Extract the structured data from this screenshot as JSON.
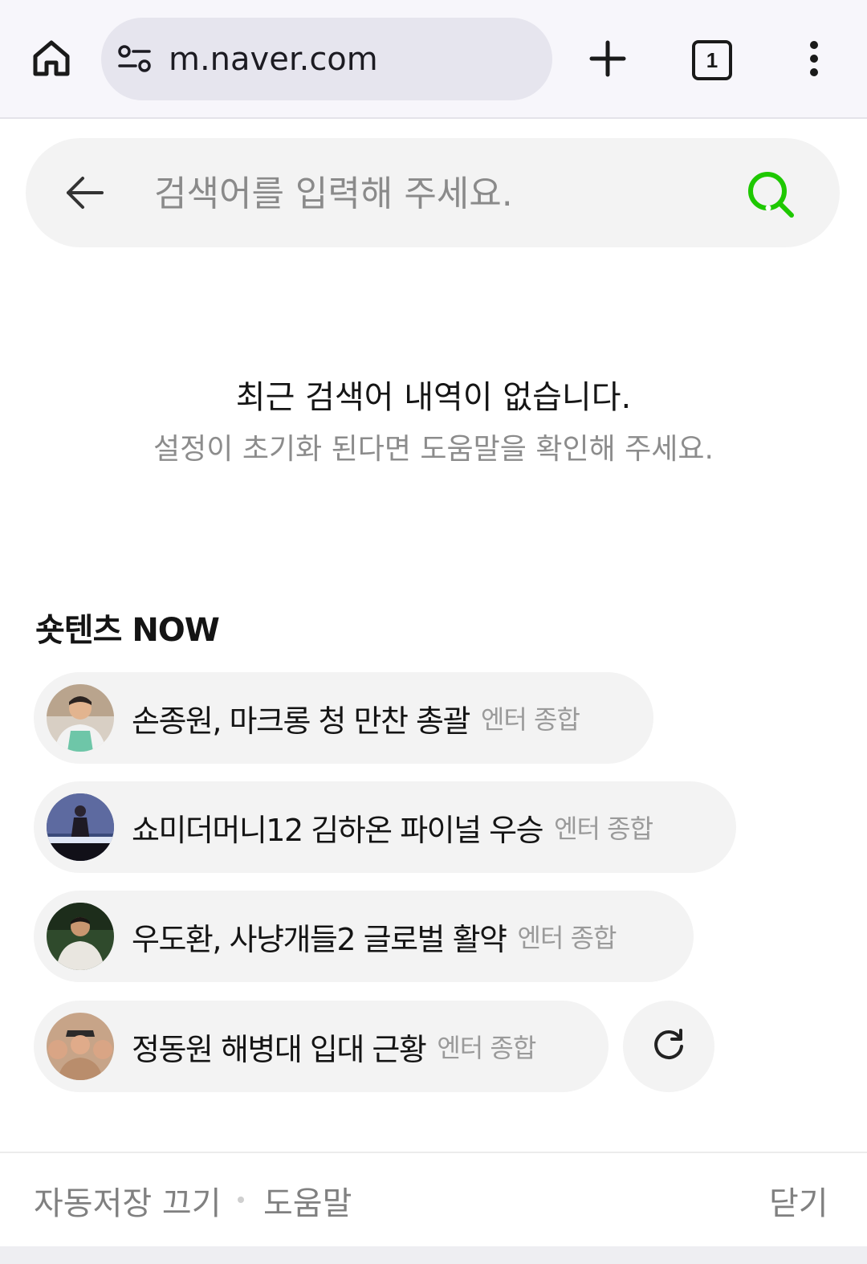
{
  "browser": {
    "url": "m.naver.com",
    "tab_count": "1",
    "icons": {
      "home": "home-icon",
      "site_settings": "site-settings-icon",
      "new_tab": "plus-icon",
      "tabs": "tab-switcher-icon",
      "menu": "more-vert-icon"
    }
  },
  "search": {
    "placeholder": "검색어를 입력해 주세요.",
    "back_icon": "arrow-left-icon",
    "search_icon": "search-icon",
    "accent_color": "#1ec800"
  },
  "recent": {
    "empty_title": "최근 검색어 내역이 없습니다.",
    "empty_subtitle": "설정이 초기화 된다면 도움말을 확인해 주세요."
  },
  "shortents": {
    "section_title": "숏텐츠 NOW",
    "items": [
      {
        "title": "손종원, 마크롱 청 만찬 총괄",
        "category": "엔터 종합"
      },
      {
        "title": "쇼미더머니12 김하온 파이널 우승",
        "category": "엔터 종합"
      },
      {
        "title": "우도환, 사냥개들2 글로벌 활약",
        "category": "엔터 종합"
      },
      {
        "title": "정동원 해병대 입대 근황",
        "category": "엔터 종합"
      }
    ],
    "refresh_icon": "refresh-icon"
  },
  "footer": {
    "autosave_off": "자동저장 끄기",
    "help": "도움말",
    "close": "닫기"
  }
}
